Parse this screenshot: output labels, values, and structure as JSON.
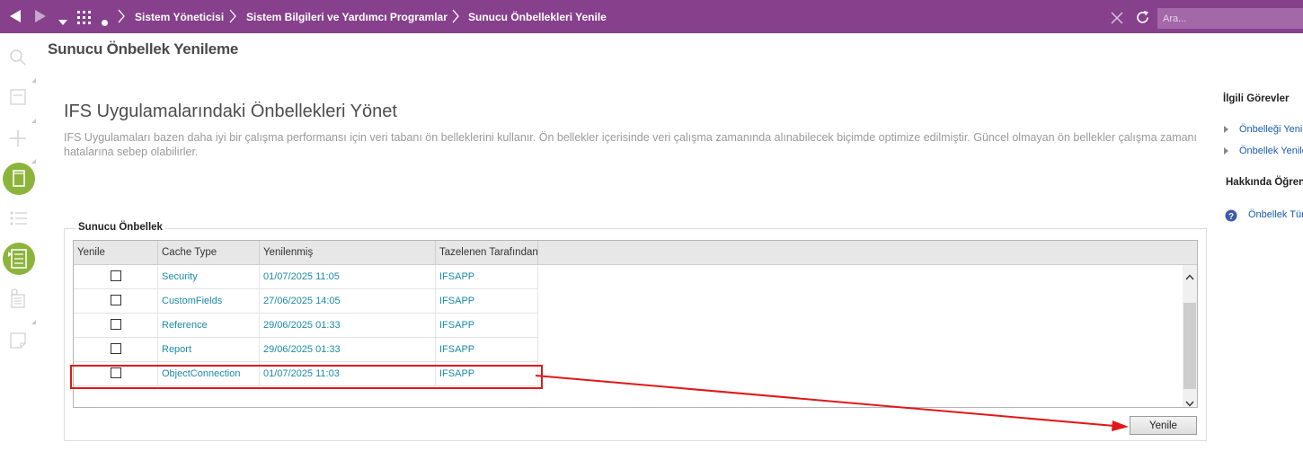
{
  "topbar": {
    "breadcrumbs": [
      "Sistem Yöneticisi",
      "Sistem Bilgileri ve Yardımcı Programlar",
      "Sunucu Önbellekleri Yenile"
    ],
    "search_placeholder": "Ara...",
    "icons": [
      "back-arrow-icon",
      "forward-arrow-icon",
      "dropdown-caret-icon",
      "app-grid-icon",
      "dot-icon",
      "close-icon",
      "refresh-icon"
    ],
    "bar_color": "#86408c"
  },
  "page": {
    "title": "Sunucu Önbellek Yenileme",
    "section_heading": "IFS Uygulamalarındaki Önbellekleri Yönet",
    "section_description": "IFS Uygulamaları bazen daha iyi bir çalışma performansı için veri tabanı ön belleklerini kullanır. Ön bellekler içerisinde veri çalışma zamanında alınabilecek biçimde optimize edilmiştir. Güncel olmayan ön bellekler çalışma zamanı hatalarına sebep olabilirler."
  },
  "group": {
    "legend": "Sunucu Önbellek",
    "columns": [
      "Yenile",
      "Cache Type",
      "Yenilenmiş",
      "Tazelenen Tarafından"
    ],
    "rows": [
      {
        "refresh": false,
        "cache_type": "Security",
        "refreshed": "01/07/2025 11:05",
        "refreshed_by": "IFSAPP"
      },
      {
        "refresh": false,
        "cache_type": "CustomFields",
        "refreshed": "27/06/2025 14:05",
        "refreshed_by": "IFSAPP"
      },
      {
        "refresh": false,
        "cache_type": "Reference",
        "refreshed": "29/06/2025 01:33",
        "refreshed_by": "IFSAPP"
      },
      {
        "refresh": false,
        "cache_type": "Report",
        "refreshed": "29/06/2025 01:33",
        "refreshed_by": "IFSAPP"
      },
      {
        "refresh": false,
        "cache_type": "ObjectConnection",
        "refreshed": "01/07/2025 11:03",
        "refreshed_by": "IFSAPP"
      }
    ],
    "button_label": "Yenile",
    "highlight_color": "#e01818"
  },
  "right_panel": {
    "related_tasks_heading": "İlgili Görevler",
    "related_tasks": [
      "Önbelleği Yenile",
      "Önbellek Yenile"
    ],
    "about_heading": "Hakkında Öğren",
    "about_links": [
      "Önbellek Tür"
    ]
  },
  "left_rail": {
    "icons": [
      "search-icon",
      "form-icon",
      "add-icon",
      "document-icon",
      "list-icon",
      "task-list-icon",
      "clipboard-icon",
      "note-icon"
    ],
    "accent": "#8cb43c"
  }
}
